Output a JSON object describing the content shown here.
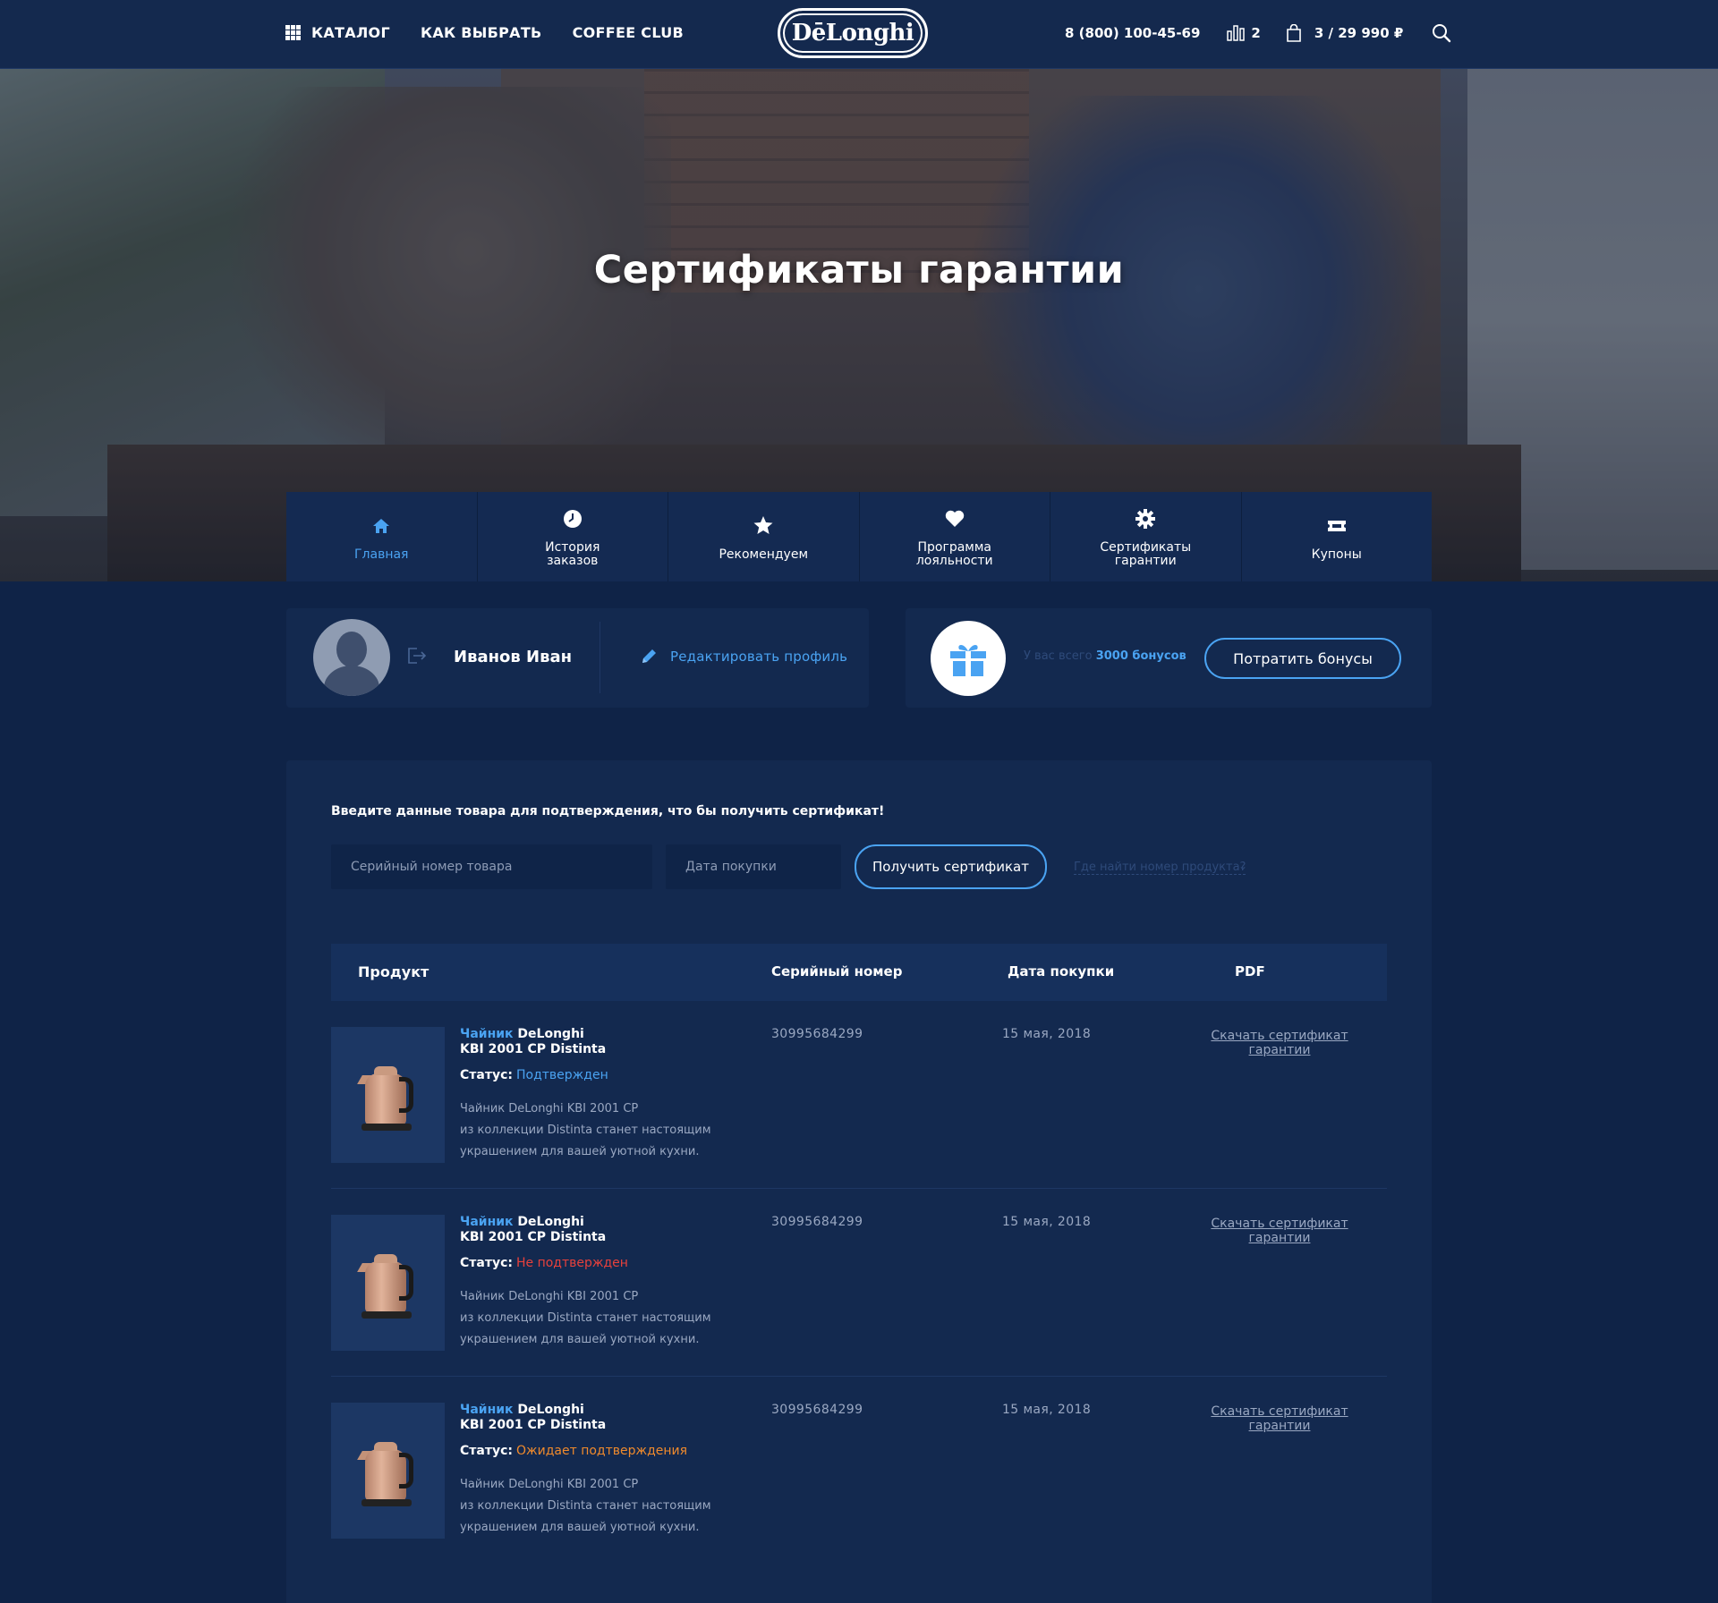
{
  "header": {
    "catalog": "КАТАЛОГ",
    "how_to_choose": "КАК ВЫБРАТЬ",
    "coffee_club": "COFFEE CLUB",
    "logo": "DēLonghi",
    "phone": "8 (800) 100-45-69",
    "compare_count": "2",
    "cart": "3 / 29 990 ₽"
  },
  "hero": {
    "title": "Сертификаты гарантии"
  },
  "tabs": [
    {
      "label": "Главная",
      "icon": "home-icon",
      "active": true
    },
    {
      "label": "История заказов",
      "icon": "clock-icon"
    },
    {
      "label": "Рекомендуем",
      "icon": "star-icon"
    },
    {
      "label": "Программа лояльности",
      "icon": "heart-icon"
    },
    {
      "label": "Сертификаты гарантии",
      "icon": "gear-icon"
    },
    {
      "label": "Купоны",
      "icon": "ticket-icon"
    }
  ],
  "profile": {
    "name": "Иванов Иван",
    "edit_label": "Редактировать профиль"
  },
  "bonus": {
    "prefix": "У вас всего",
    "amount": "3000 бонусов",
    "spend_label": "Потратить бонусы"
  },
  "form": {
    "intro": "Введите данные товара для подтверждения, что бы получить сертификат!",
    "serial_placeholder": "Серийный номер товара",
    "date_placeholder": "Дата покупки",
    "submit_label": "Получить сертификат",
    "help_link": "Где найти номер продукта?"
  },
  "table": {
    "headers": {
      "product": "Продукт",
      "serial": "Серийный номер",
      "date": "Дата покупки",
      "pdf": "PDF"
    },
    "status_label": "Статус:",
    "rows": [
      {
        "name_accent": "Чайник",
        "name_rest": " DeLonghi",
        "name_line2": "KBI 2001 CP Distinta",
        "status": "Подтвержден",
        "status_color": "#4aa3f2",
        "desc_1": "Чайник DeLonghi KBI 2001 CP",
        "desc_2": "из коллекции Distinta станет настоящим",
        "desc_3": "украшением для вашей уютной кухни.",
        "serial": "30995684299",
        "date": "15 мая, 2018",
        "pdf_1": "Скачать сертификат",
        "pdf_2": "гарантии"
      },
      {
        "name_accent": "Чайник",
        "name_rest": " DeLonghi",
        "name_line2": "KBI 2001 CP Distinta",
        "status": "Не подтвержден",
        "status_color": "#e8413c",
        "desc_1": "Чайник DeLonghi KBI 2001 CP",
        "desc_2": "из коллекции Distinta станет настоящим",
        "desc_3": "украшением для вашей уютной кухни.",
        "serial": "30995684299",
        "date": "15 мая, 2018",
        "pdf_1": "Скачать сертификат",
        "pdf_2": "гарантии"
      },
      {
        "name_accent": "Чайник",
        "name_rest": " DeLonghi",
        "name_line2": "KBI 2001 CP Distinta",
        "status": "Ожидает подтверждения",
        "status_color": "#f08a2c",
        "desc_1": "Чайник DeLonghi KBI 2001 CP",
        "desc_2": "из коллекции Distinta станет настоящим",
        "desc_3": "украшением для вашей уютной кухни.",
        "serial": "30995684299",
        "date": "15 мая, 2018",
        "pdf_1": "Скачать сертификат",
        "pdf_2": "гарантии"
      }
    ]
  },
  "colors": {
    "accent": "#4aa3f2",
    "background": "#0f2347",
    "panel": "#13294f"
  }
}
